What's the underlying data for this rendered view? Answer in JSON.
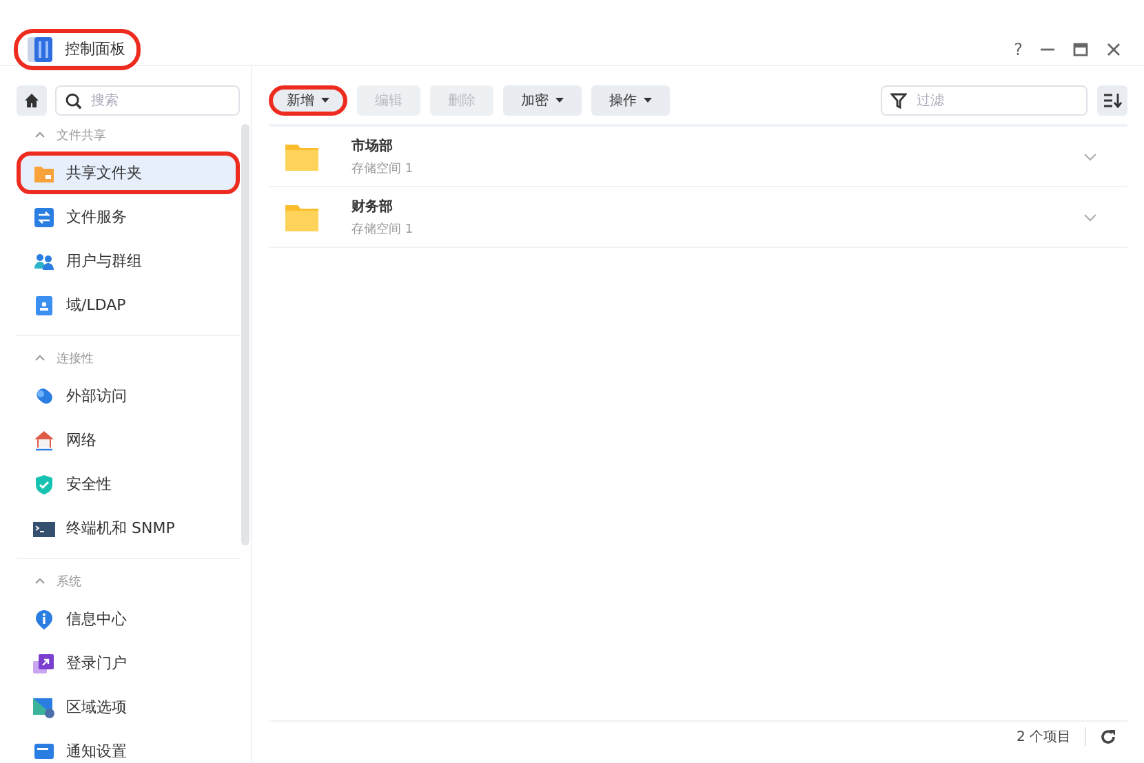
{
  "window": {
    "title": "控制面板",
    "highlighted": true,
    "controls": [
      "?"
    ]
  },
  "sidebar": {
    "search": {
      "placeholder": "搜索"
    },
    "sections": [
      {
        "title": "文件共享",
        "expanded": true,
        "items": [
          {
            "label": "共享文件夹",
            "selected": true,
            "highlighted": true
          },
          {
            "label": "文件服务",
            "selected": false,
            "highlighted": false
          },
          {
            "label": "用户与群组",
            "selected": false,
            "highlighted": false
          },
          {
            "label": "域/LDAP",
            "selected": false,
            "highlighted": false
          }
        ]
      },
      {
        "title": "连接性",
        "expanded": true,
        "items": [
          {
            "label": "外部访问",
            "selected": false,
            "highlighted": false
          },
          {
            "label": "网络",
            "selected": false,
            "highlighted": false
          },
          {
            "label": "安全性",
            "selected": false,
            "highlighted": false
          },
          {
            "label": "终端机和 SNMP",
            "selected": false,
            "highlighted": false
          }
        ]
      },
      {
        "title": "系统",
        "expanded": true,
        "items": [
          {
            "label": "信息中心",
            "selected": false,
            "highlighted": false
          },
          {
            "label": "登录门户",
            "selected": false,
            "highlighted": false
          },
          {
            "label": "区域选项",
            "selected": false,
            "highlighted": false
          },
          {
            "label": "通知设置",
            "selected": false,
            "highlighted": false
          }
        ]
      }
    ]
  },
  "toolbar": {
    "buttons": [
      {
        "label": "新增",
        "disabled": false,
        "dropdown": true,
        "highlighted": true
      },
      {
        "label": "编辑",
        "disabled": true,
        "dropdown": false,
        "highlighted": false
      },
      {
        "label": "删除",
        "disabled": true,
        "dropdown": false,
        "highlighted": false
      },
      {
        "label": "加密",
        "disabled": false,
        "dropdown": true,
        "highlighted": false
      },
      {
        "label": "操作",
        "disabled": false,
        "dropdown": true,
        "highlighted": false
      }
    ],
    "filter": {
      "placeholder": "过滤"
    }
  },
  "folders": [
    {
      "name": "市场部",
      "location": "存储空间 1",
      "expanded": false
    },
    {
      "name": "财务部",
      "location": "存储空间 1",
      "expanded": false
    }
  ],
  "status_bar": {
    "count": "2 个项目"
  }
}
